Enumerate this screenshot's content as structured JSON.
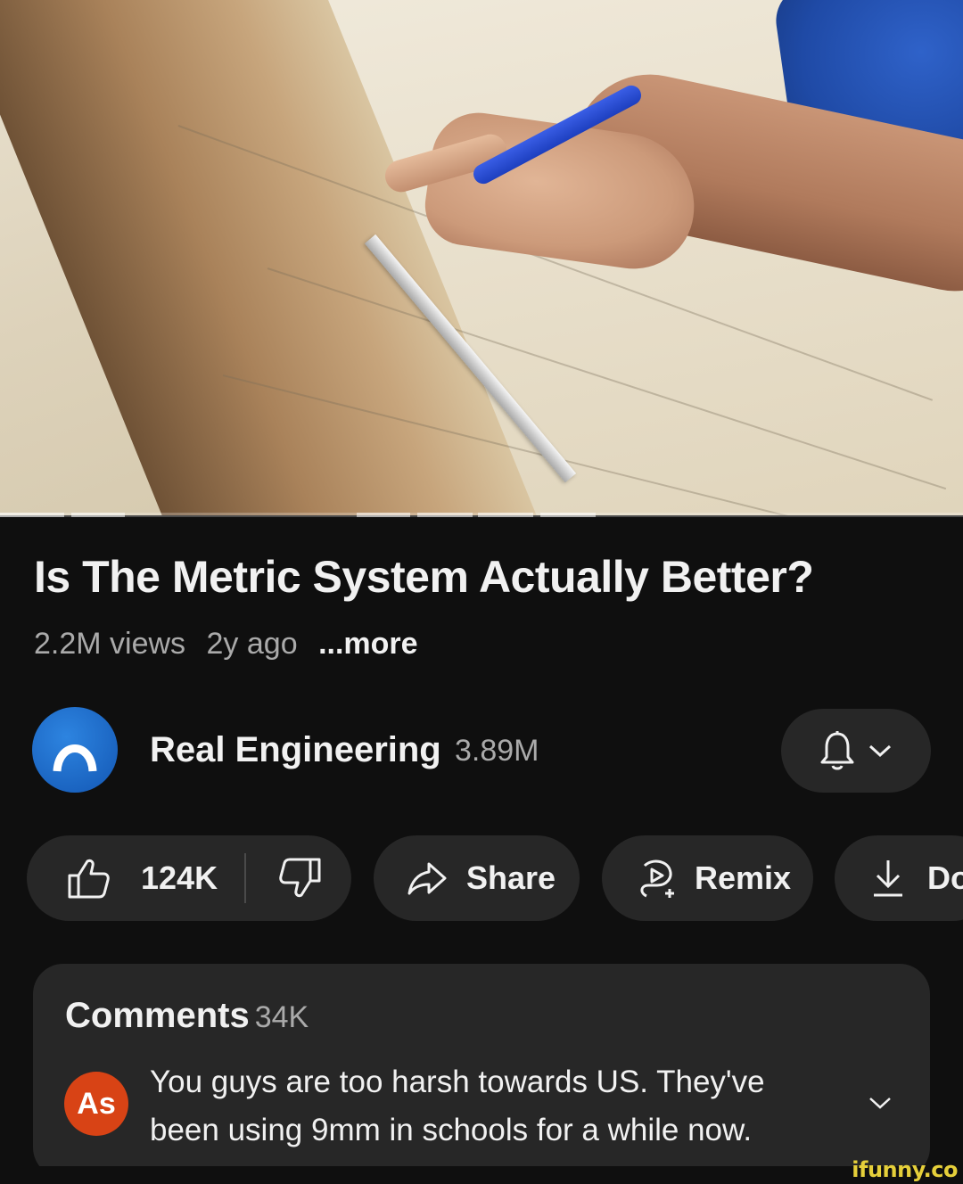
{
  "video": {
    "title": "Is The Metric System Actually Better?",
    "views": "2.2M views",
    "age": "2y ago",
    "more_label": "...more"
  },
  "channel": {
    "name": "Real Engineering",
    "subscribers": "3.89M",
    "avatar_icon": "arch-logo-icon",
    "avatar_color": "#1a6fd1",
    "bell_icon": "bell-icon"
  },
  "actions": {
    "like_count": "124K",
    "share_label": "Share",
    "remix_label": "Remix",
    "download_label": "Download"
  },
  "comments": {
    "title": "Comments",
    "count": "34K",
    "top_comment": {
      "avatar_initials": "As",
      "avatar_color": "#d84315",
      "text": "You guys are too harsh towards US. They've been using 9mm in schools for a while now."
    }
  },
  "watermark": "ifunny.co",
  "colors": {
    "background": "#0f0f0f",
    "surface": "#272727",
    "text_primary": "#f1f1f1",
    "text_secondary": "#aaaaaa"
  }
}
